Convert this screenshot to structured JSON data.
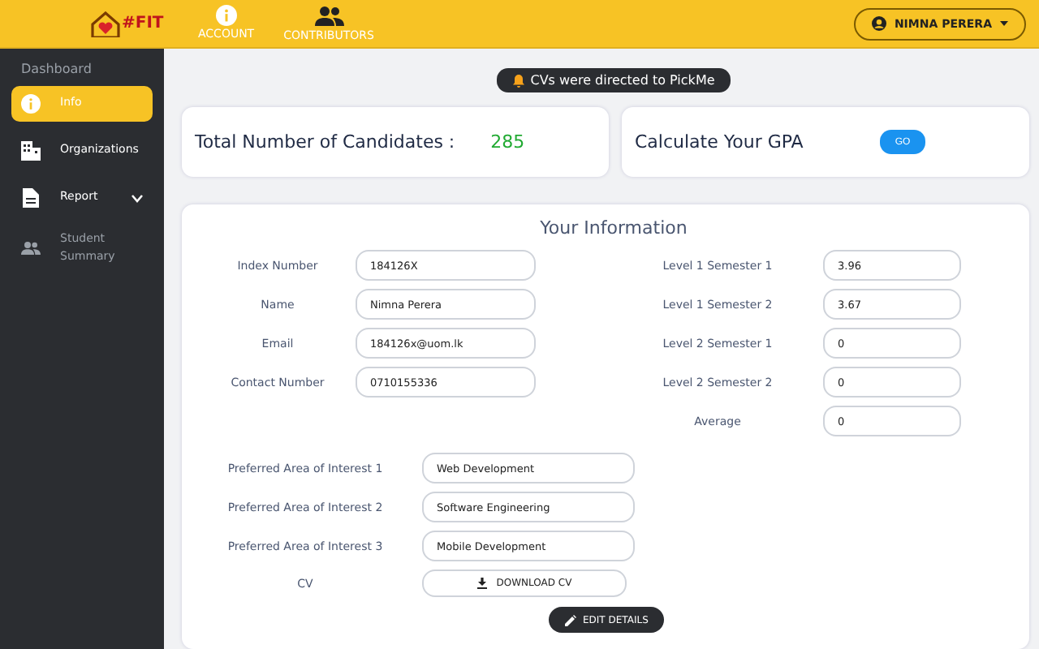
{
  "header": {
    "logo_text": "#FIT",
    "nav": [
      {
        "label": "ACCOUNT",
        "kind": "info"
      },
      {
        "label": "CONTRIBUTORS",
        "kind": "people"
      }
    ],
    "user_menu": {
      "label": "NIMNA PERERA"
    }
  },
  "sidebar": {
    "heading": "Dashboard",
    "items": [
      {
        "label": "Info",
        "kind": "info",
        "selected": true,
        "disabled": false
      },
      {
        "label": "Organizations",
        "kind": "building",
        "selected": false,
        "disabled": false
      },
      {
        "label": "Report",
        "kind": "report",
        "selected": false,
        "disabled": false,
        "expanded": false
      },
      {
        "label": "Student Summary",
        "kind": "people",
        "selected": false,
        "disabled": true
      }
    ]
  },
  "notice": "CVs were directed to PickMe",
  "stats": {
    "label": "Total Number of Candidates :",
    "value": "285"
  },
  "gpa": {
    "label": "Calculate Your GPA",
    "button": "GO"
  },
  "info": {
    "title": "Your Information",
    "left_fields": [
      {
        "label": "Index Number",
        "value": "184126X"
      },
      {
        "label": "Name",
        "value": "Nimna Perera"
      },
      {
        "label": "Email",
        "value": "184126x@uom.lk"
      },
      {
        "label": "Contact Number",
        "value": "0710155336"
      }
    ],
    "right_fields": [
      {
        "label": "Level 1 Semester 1",
        "value": "3.96"
      },
      {
        "label": "Level 1 Semester 2",
        "value": "3.67"
      },
      {
        "label": "Level 2 Semester 1",
        "value": "0"
      },
      {
        "label": "Level 2 Semester 2",
        "value": "0"
      },
      {
        "label": "Average",
        "value": "0"
      }
    ],
    "interests": [
      {
        "label": "Preferred Area of Interest 1",
        "value": "Web Development"
      },
      {
        "label": "Preferred Area of Interest 2",
        "value": "Software Engineering"
      },
      {
        "label": "Preferred Area of Interest 3",
        "value": "Mobile Development"
      }
    ],
    "cv": {
      "label": "CV",
      "button": "DOWNLOAD CV"
    },
    "edit_button": "EDIT DETAILS"
  }
}
